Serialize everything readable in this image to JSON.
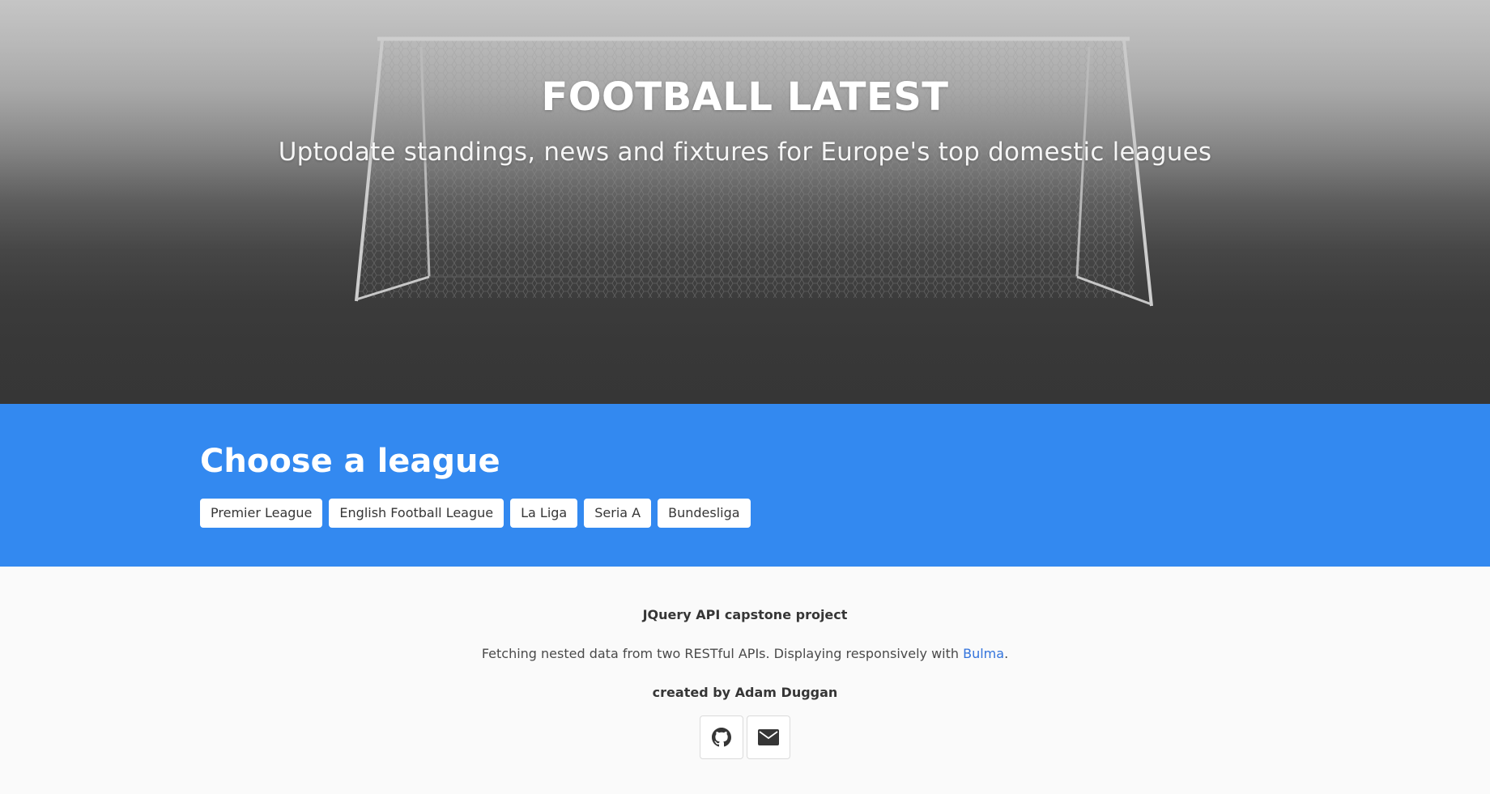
{
  "hero": {
    "title": "FOOTBALL LATEST",
    "subtitle": "Uptodate standings, news and fixtures for Europe's top domestic leagues"
  },
  "leagues": {
    "heading": "Choose a league",
    "buttons": [
      {
        "label": "Premier League"
      },
      {
        "label": "English Football League"
      },
      {
        "label": "La Liga"
      },
      {
        "label": "Seria A"
      },
      {
        "label": "Bundesliga"
      }
    ]
  },
  "footer": {
    "project": "JQuery API capstone project",
    "description_prefix": "Fetching nested data from two RESTful APIs. Displaying responsively with ",
    "description_link": "Bulma",
    "description_suffix": ".",
    "credit": "created by Adam Duggan",
    "icons": [
      {
        "name": "github-icon"
      },
      {
        "name": "envelope-icon"
      }
    ]
  },
  "colors": {
    "primary": "#3389f0",
    "link": "#3273dc",
    "text": "#363636",
    "footer_bg": "#fafafa"
  }
}
